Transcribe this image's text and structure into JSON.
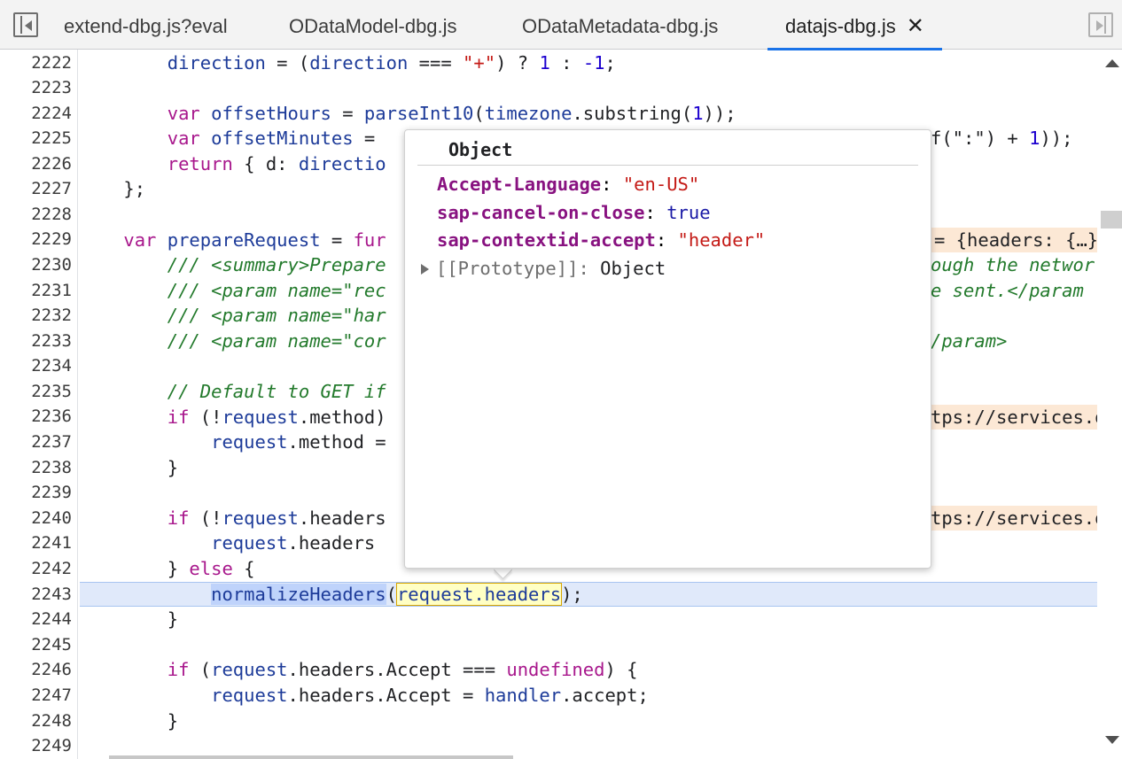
{
  "tabs": [
    {
      "label": "extend-dbg.js?eval",
      "active": false
    },
    {
      "label": "ODataModel-dbg.js",
      "active": false
    },
    {
      "label": "ODataMetadata-dbg.js",
      "active": false
    },
    {
      "label": "datajs-dbg.js",
      "active": true,
      "close": "✕"
    }
  ],
  "gutter": {
    "line_numbers": [
      "2222",
      "2223",
      "2224",
      "2225",
      "2226",
      "2227",
      "2228",
      "2229",
      "2230",
      "2231",
      "2232",
      "2233",
      "2234",
      "2235",
      "2236",
      "2237",
      "2238",
      "2239",
      "2240",
      "2241",
      "2242",
      "2243",
      "2244",
      "2245",
      "2246",
      "2247",
      "2248",
      "2249"
    ]
  },
  "code": {
    "l2222": {
      "a": "        ",
      "b": "direction",
      "c": " = (",
      "d": "direction",
      "e": " === ",
      "f": "\"+\"",
      "g": ") ? ",
      "h": "1",
      "i": " : ",
      "j": "-1",
      "k": ";"
    },
    "l2224": {
      "a": "        ",
      "b": "var",
      "c": " ",
      "d": "offsetHours",
      "e": " = ",
      "f": "parseInt10",
      "g": "(",
      "h": "timezone",
      "i": ".substring(",
      "j": "1",
      "k": "));"
    },
    "l2225": {
      "a": "        ",
      "b": "var",
      "c": " ",
      "d": "offsetMinutes",
      "e": " = ",
      "tail1": "f(\":\") + ",
      "tail2": "1",
      "tail3": "));"
    },
    "l2226": {
      "a": "        ",
      "b": "return",
      "c": " { d: ",
      "d": "directio"
    },
    "l2227": {
      "a": "    };"
    },
    "l2229": {
      "a": "    ",
      "b": "var",
      "c": " ",
      "d": "prepareRequest",
      "e": " = ",
      "f": "fur",
      "tail": "= {headers: {…},"
    },
    "l2230": {
      "a": "        ",
      "b": "/// <summary>Prepare",
      "tail": "ough the networ"
    },
    "l2231": {
      "a": "        ",
      "b": "/// <param name=\"rec",
      "tail": "e sent.</param"
    },
    "l2232": {
      "a": "        ",
      "b": "/// <param name=\"har"
    },
    "l2233": {
      "a": "        ",
      "b": "/// <param name=\"cor",
      "tail": "/param>"
    },
    "l2235": {
      "a": "        ",
      "b": "// Default to GET if"
    },
    "l2236": {
      "a": "        ",
      "b": "if",
      "c": " (!",
      "d": "request",
      "e": ".method)",
      "tail": "tps://services.od"
    },
    "l2237": {
      "a": "            ",
      "b": "request",
      "c": ".method ="
    },
    "l2238": {
      "a": "        }"
    },
    "l2240": {
      "a": "        ",
      "b": "if",
      "c": " (!",
      "d": "request",
      "e": ".headers",
      "tail": "tps://services.o"
    },
    "l2241": {
      "a": "            ",
      "b": "request",
      "c": ".headers"
    },
    "l2242": {
      "a": "        } ",
      "b": "else",
      "c": " {"
    },
    "l2243": {
      "a": "            ",
      "b": "normalizeHeaders",
      "c": "(",
      "d": "request.headers",
      "e": ");"
    },
    "l2244": {
      "a": "        }"
    },
    "l2246": {
      "a": "        ",
      "b": "if",
      "c": " (",
      "d": "request",
      "e": ".headers.Accept === ",
      "f": "undefined",
      "g": ") {"
    },
    "l2247": {
      "a": "            ",
      "b": "request",
      "c": ".headers.Accept = ",
      "d": "handler",
      "e": ".accept;"
    },
    "l2248": {
      "a": "        }"
    }
  },
  "popover": {
    "title": "Object",
    "properties": [
      {
        "key": "Accept-Language",
        "sep": ": ",
        "value": "\"en-US\"",
        "kind": "string"
      },
      {
        "key": "sap-cancel-on-close",
        "sep": ": ",
        "value": "true",
        "kind": "boolean"
      },
      {
        "key": "sap-contextid-accept",
        "sep": ": ",
        "value": "\"header\"",
        "kind": "string"
      }
    ],
    "prototype": {
      "label": "[[Prototype]]",
      "sep": ": ",
      "value": "Object"
    }
  },
  "colors": {
    "accent": "#1a73e8",
    "keyword": "#a8178c",
    "identifier": "#1d3b99",
    "string": "#c41a16",
    "comment": "#237a2c",
    "current_line": "#e0e9fa"
  },
  "icons": {
    "nav_left": "collapse-navigator-icon",
    "nav_right": "collapse-debugger-icon",
    "scroll_up": "scroll-up-arrow-icon",
    "scroll_down": "scroll-down-arrow-icon",
    "prototype_expand": "expand-triangle-icon"
  }
}
